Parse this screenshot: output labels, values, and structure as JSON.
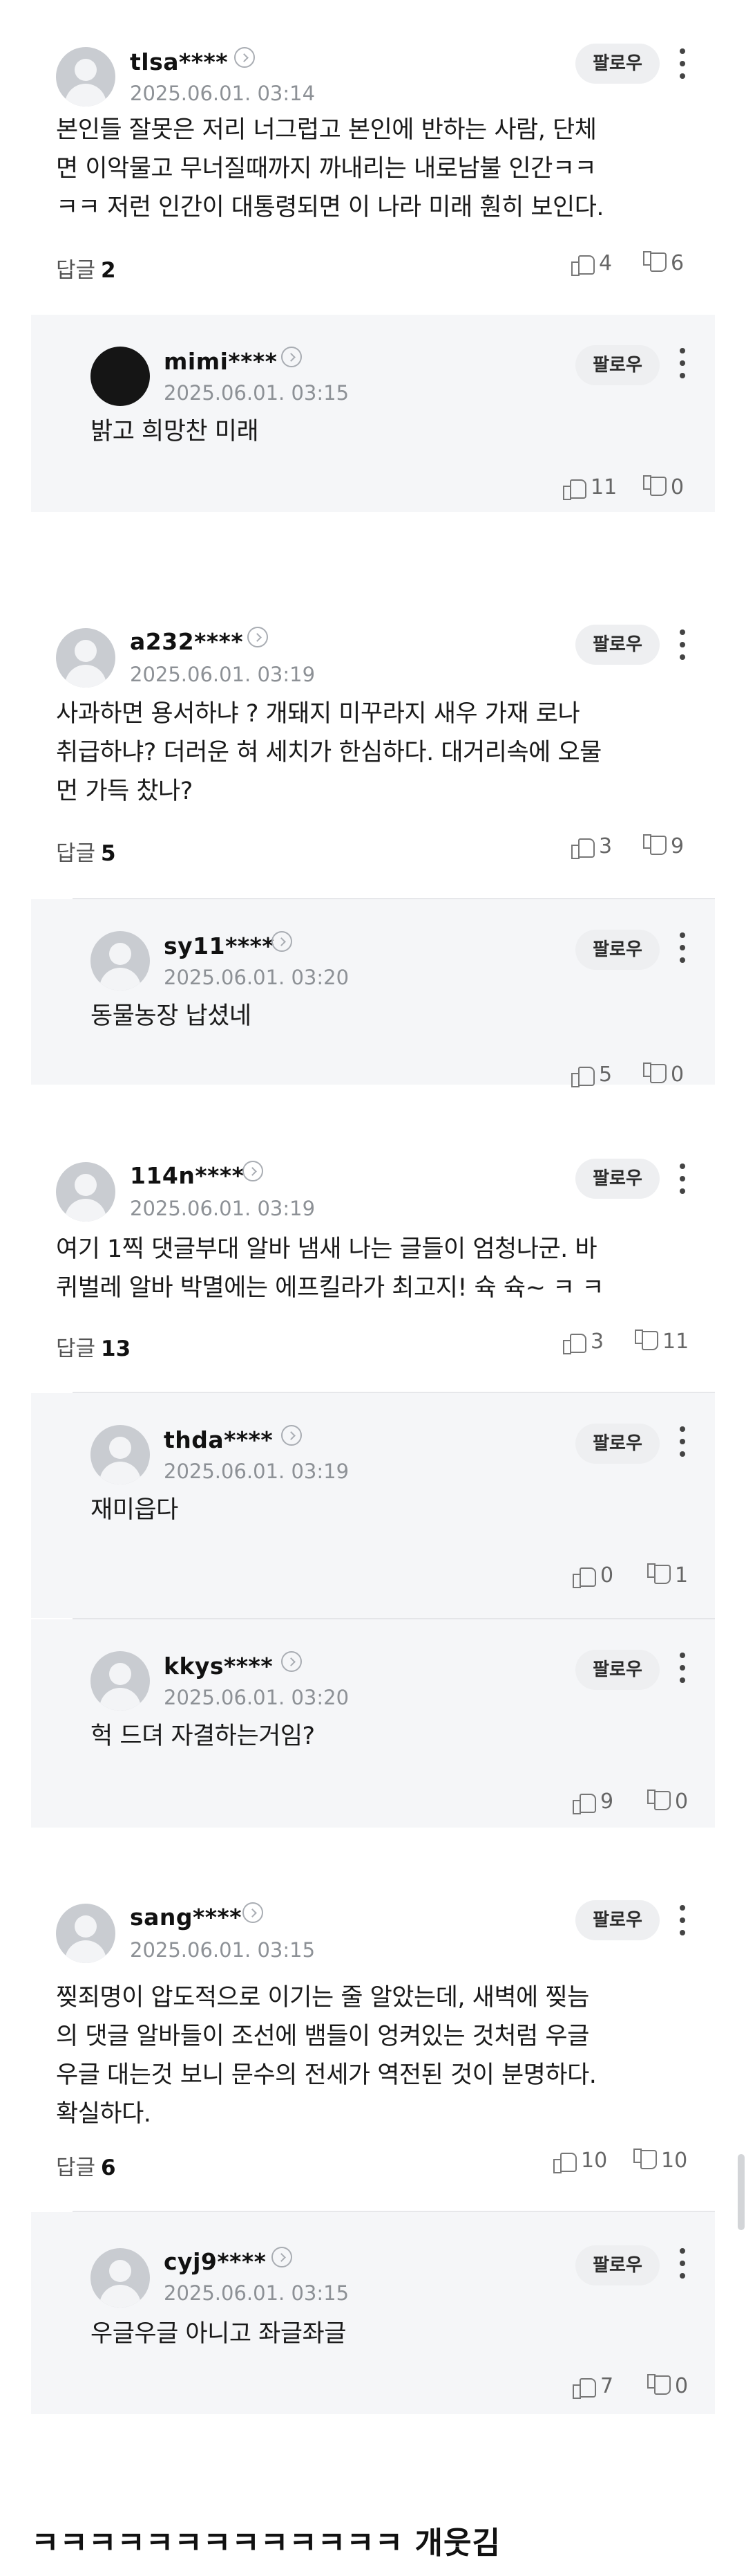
{
  "follow_label": "팔로우",
  "reply_label": "답글",
  "threads": [
    {
      "comment": {
        "username": "tlsa****",
        "time": "2025.06.01. 03:14",
        "lines": [
          "본인들 잘못은 저리 너그럽고 본인에 반하는 사람, 단체",
          "면 이악물고 무너질때까지 까내리는 내로남불 인간ㅋㅋ",
          "ㅋㅋ 저런 인간이 대통령되면 이 나라 미래 훤히 보인다."
        ],
        "reply_count": "2",
        "likes": "4",
        "dislikes": "6"
      },
      "replies": [
        {
          "username": "mimi****",
          "time": "2025.06.01. 03:15",
          "text": "밝고 희망찬 미래",
          "likes": "11",
          "dislikes": "0",
          "dark_avatar": true
        }
      ]
    },
    {
      "comment": {
        "username": "a232****",
        "time": "2025.06.01. 03:19",
        "lines": [
          "사과하면 용서하냐 ? 개돼지 미꾸라지 새우 가재 로나",
          "취급하냐? 더러운 혀 세치가 한심하다. 대거리속에 오물",
          "먼 가득 찼나?"
        ],
        "reply_count": "5",
        "likes": "3",
        "dislikes": "9"
      },
      "replies": [
        {
          "username": "sy11****",
          "time": "2025.06.01. 03:20",
          "text": "동물농장 납셨네",
          "likes": "5",
          "dislikes": "0"
        }
      ]
    },
    {
      "comment": {
        "username": "114n****",
        "time": "2025.06.01. 03:19",
        "lines": [
          "여기 1찍 댓글부대 알바 냄새 나는 글들이 엄청나군. 바",
          "퀴벌레 알바 박멸에는 에프킬라가 최고지! 슉 슉~ ㅋ ㅋ"
        ],
        "reply_count": "13",
        "likes": "3",
        "dislikes": "11"
      },
      "replies": [
        {
          "username": "thda****",
          "time": "2025.06.01. 03:19",
          "text": "재미읍다",
          "likes": "0",
          "dislikes": "1"
        },
        {
          "username": "kkys****",
          "time": "2025.06.01. 03:20",
          "text": "헉 드뎌 자결하는거임?",
          "likes": "9",
          "dislikes": "0"
        }
      ]
    },
    {
      "comment": {
        "username": "sang****",
        "time": "2025.06.01. 03:15",
        "lines": [
          "찢죄명이 압도적으로 이기는 줄 알았는데, 새벽에 찢늠",
          "의 댓글 알바들이 조선에 뱀들이 엉켜있는 것처럼 우글",
          "우글 대는것 보니 문수의 전세가 역전된 것이 분명하다.",
          "확실하다."
        ],
        "reply_count": "6",
        "likes": "10",
        "dislikes": "10"
      },
      "replies": [
        {
          "username": "cyj9****",
          "time": "2025.06.01. 03:15",
          "text": "우글우글 아니고 좌글좌글",
          "likes": "7",
          "dislikes": "0"
        }
      ]
    }
  ],
  "bottom_text": "ㅋㅋㅋㅋㅋㅋㅋㅋㅋㅋㅋㅋㅋ 개웃김"
}
